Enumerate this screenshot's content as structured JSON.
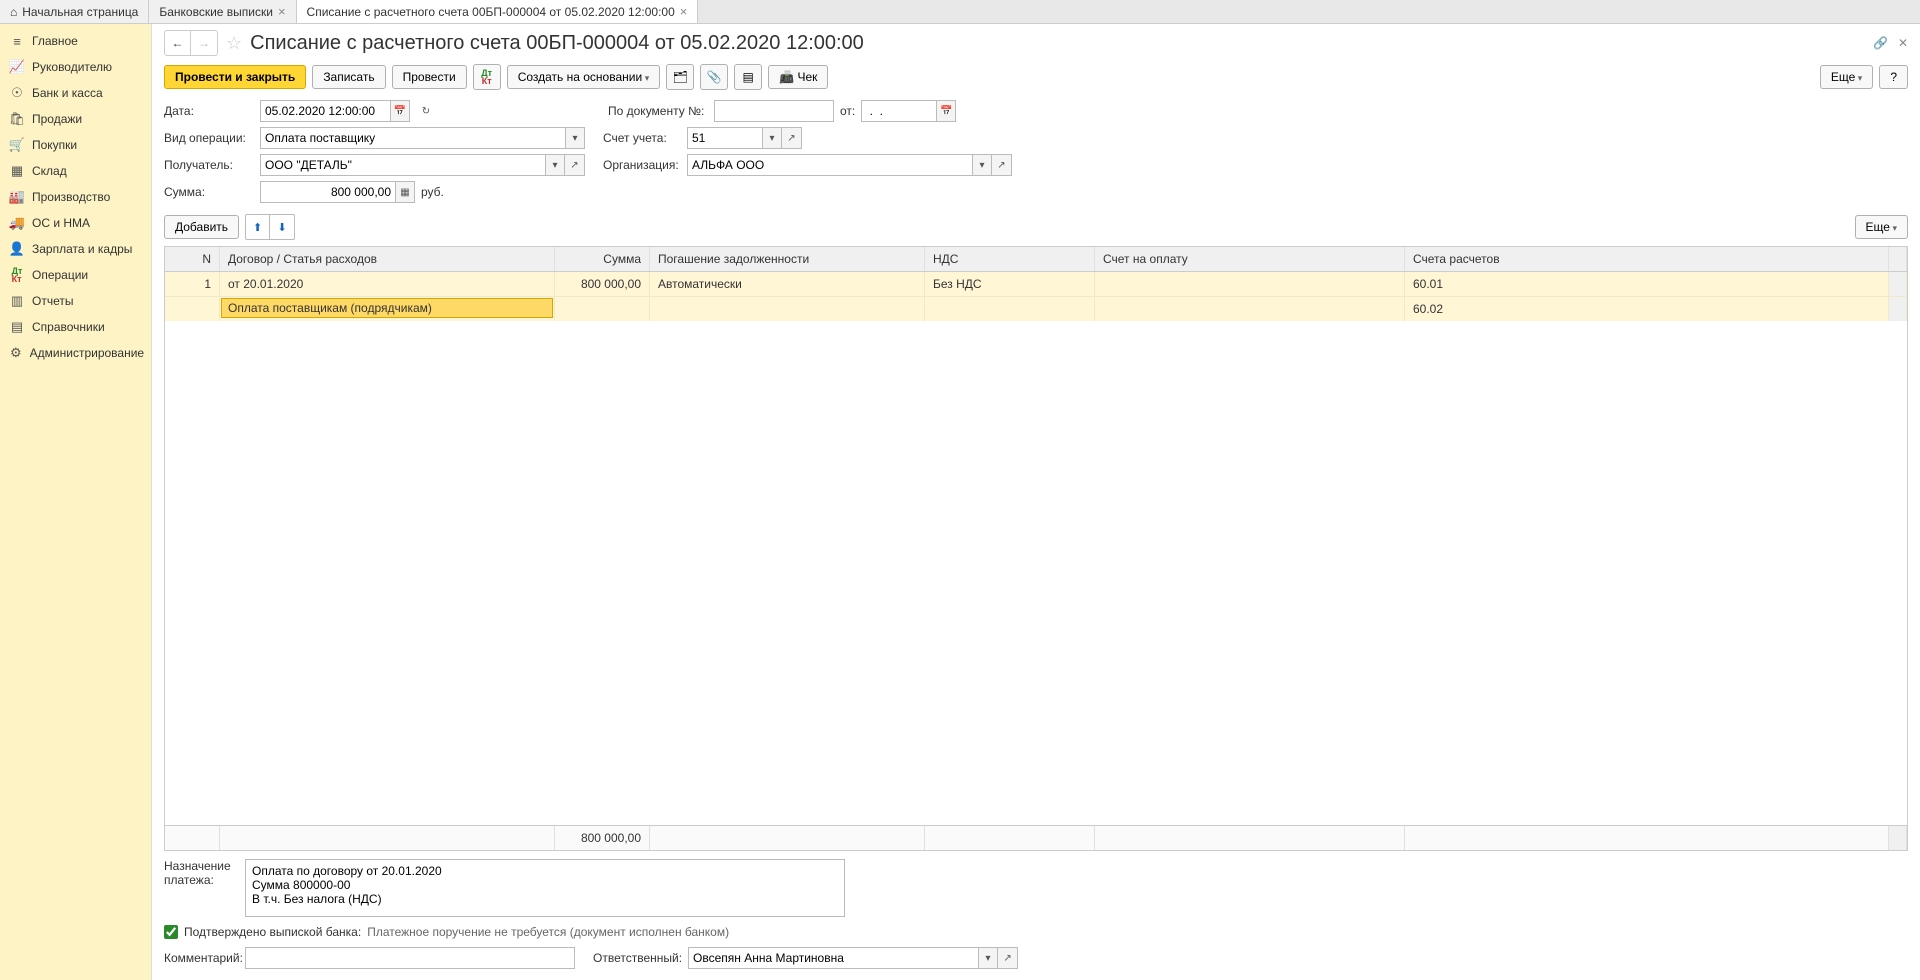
{
  "tabs": {
    "home": "Начальная страница",
    "tab1": "Банковские выписки",
    "tab2": "Списание с расчетного счета 00БП-000004 от 05.02.2020 12:00:00"
  },
  "sidebar": {
    "main": "Главное",
    "manager": "Руководителю",
    "bank": "Банк и касса",
    "sales": "Продажи",
    "purchases": "Покупки",
    "warehouse": "Склад",
    "production": "Производство",
    "assets": "ОС и НМА",
    "payroll": "Зарплата и кадры",
    "operations": "Операции",
    "reports": "Отчеты",
    "references": "Справочники",
    "admin": "Администрирование"
  },
  "title": "Списание с расчетного счета 00БП-000004 от 05.02.2020 12:00:00",
  "toolbar": {
    "post_close": "Провести и закрыть",
    "save": "Записать",
    "post": "Провести",
    "create_based": "Создать на основании",
    "check": "Чек",
    "more": "Еще",
    "help": "?"
  },
  "form": {
    "date_lbl": "Дата:",
    "date_val": "05.02.2020 12:00:00",
    "doc_num_lbl": "По документу №:",
    "from_lbl": "от:",
    "from_val": " .  .    ",
    "op_type_lbl": "Вид операции:",
    "op_type_val": "Оплата поставщику",
    "account_lbl": "Счет учета:",
    "account_val": "51",
    "recipient_lbl": "Получатель:",
    "recipient_val": "ООО \"ДЕТАЛЬ\"",
    "org_lbl": "Организация:",
    "org_val": "АЛЬФА ООО",
    "sum_lbl": "Сумма:",
    "sum_val": "800 000,00",
    "currency": "руб."
  },
  "table_toolbar": {
    "add": "Добавить",
    "more": "Еще"
  },
  "table": {
    "headers": {
      "n": "N",
      "contract": "Договор / Статья расходов",
      "sum": "Сумма",
      "debt": "Погашение задолженности",
      "nds": "НДС",
      "invoice": "Счет на оплату",
      "accounts": "Счета расчетов"
    },
    "row": {
      "n": "1",
      "contract1": "от 20.01.2020",
      "contract2": "Оплата поставщикам (подрядчикам)",
      "sum": "800 000,00",
      "debt": "Автоматически",
      "nds": "Без НДС",
      "acct1": "60.01",
      "acct2": "60.02"
    },
    "footer_sum": "800 000,00"
  },
  "bottom": {
    "purpose_lbl": "Назначение платежа:",
    "purpose_val": "Оплата по договору от 20.01.2020\nСумма 800000-00\nВ т.ч. Без налога (НДС)",
    "confirmed_lbl": "Подтверждено выпиской банка:",
    "info": "Платежное поручение не требуется (документ исполнен банком)",
    "comment_lbl": "Комментарий:",
    "responsible_lbl": "Ответственный:",
    "responsible_val": "Овсепян Анна Мартиновна"
  }
}
